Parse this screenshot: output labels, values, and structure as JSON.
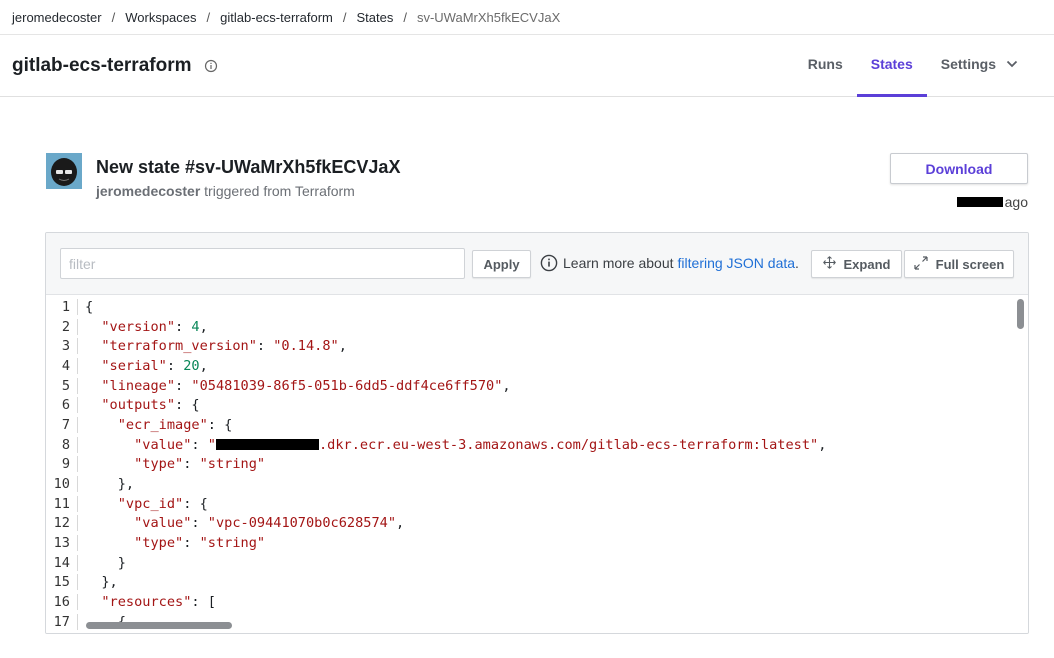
{
  "breadcrumb": {
    "items": [
      "jeromedecoster",
      "Workspaces",
      "gitlab-ecs-terraform",
      "States",
      "sv-UWaMrXh5fkECVJaX"
    ],
    "separator": "/"
  },
  "header": {
    "title": "gitlab-ecs-terraform",
    "tabs": [
      {
        "label": "Runs",
        "active": false
      },
      {
        "label": "States",
        "active": true
      },
      {
        "label": "Settings",
        "active": false
      }
    ]
  },
  "state": {
    "title": "New state #sv-UWaMrXh5fkECVJaX",
    "user": "jeromedecoster",
    "trigger_text": " triggered from Terraform",
    "download_label": "Download",
    "time_suffix": "ago"
  },
  "viewer": {
    "filter_placeholder": "filter",
    "apply_label": "Apply",
    "learn_text": "Learn more about",
    "learn_link": "filtering JSON data",
    "learn_end": ".",
    "expand_label": "Expand",
    "fullscreen_label": "Full screen",
    "lines": [
      {
        "n": "1",
        "segments": [
          {
            "t": "p",
            "v": "{"
          }
        ]
      },
      {
        "n": "2",
        "segments": [
          {
            "t": "p",
            "v": "  "
          },
          {
            "t": "k",
            "v": "\"version\""
          },
          {
            "t": "p",
            "v": ": "
          },
          {
            "t": "n",
            "v": "4"
          },
          {
            "t": "p",
            "v": ","
          }
        ]
      },
      {
        "n": "3",
        "segments": [
          {
            "t": "p",
            "v": "  "
          },
          {
            "t": "k",
            "v": "\"terraform_version\""
          },
          {
            "t": "p",
            "v": ": "
          },
          {
            "t": "s",
            "v": "\"0.14.8\""
          },
          {
            "t": "p",
            "v": ","
          }
        ]
      },
      {
        "n": "4",
        "segments": [
          {
            "t": "p",
            "v": "  "
          },
          {
            "t": "k",
            "v": "\"serial\""
          },
          {
            "t": "p",
            "v": ": "
          },
          {
            "t": "n",
            "v": "20"
          },
          {
            "t": "p",
            "v": ","
          }
        ]
      },
      {
        "n": "5",
        "segments": [
          {
            "t": "p",
            "v": "  "
          },
          {
            "t": "k",
            "v": "\"lineage\""
          },
          {
            "t": "p",
            "v": ": "
          },
          {
            "t": "s",
            "v": "\"05481039-86f5-051b-6dd5-ddf4ce6ff570\""
          },
          {
            "t": "p",
            "v": ","
          }
        ]
      },
      {
        "n": "6",
        "segments": [
          {
            "t": "p",
            "v": "  "
          },
          {
            "t": "k",
            "v": "\"outputs\""
          },
          {
            "t": "p",
            "v": ": {"
          }
        ]
      },
      {
        "n": "7",
        "segments": [
          {
            "t": "p",
            "v": "    "
          },
          {
            "t": "k",
            "v": "\"ecr_image\""
          },
          {
            "t": "p",
            "v": ": {"
          }
        ]
      },
      {
        "n": "8",
        "segments": [
          {
            "t": "p",
            "v": "      "
          },
          {
            "t": "k",
            "v": "\"value\""
          },
          {
            "t": "p",
            "v": ": "
          },
          {
            "t": "s",
            "v": "\""
          },
          {
            "t": "redact",
            "v": ""
          },
          {
            "t": "s",
            "v": ".dkr.ecr.eu-west-3.amazonaws.com/gitlab-ecs-terraform:latest\""
          },
          {
            "t": "p",
            "v": ","
          }
        ]
      },
      {
        "n": "9",
        "segments": [
          {
            "t": "p",
            "v": "      "
          },
          {
            "t": "k",
            "v": "\"type\""
          },
          {
            "t": "p",
            "v": ": "
          },
          {
            "t": "s",
            "v": "\"string\""
          }
        ]
      },
      {
        "n": "10",
        "segments": [
          {
            "t": "p",
            "v": "    },"
          }
        ]
      },
      {
        "n": "11",
        "segments": [
          {
            "t": "p",
            "v": "    "
          },
          {
            "t": "k",
            "v": "\"vpc_id\""
          },
          {
            "t": "p",
            "v": ": {"
          }
        ]
      },
      {
        "n": "12",
        "segments": [
          {
            "t": "p",
            "v": "      "
          },
          {
            "t": "k",
            "v": "\"value\""
          },
          {
            "t": "p",
            "v": ": "
          },
          {
            "t": "s",
            "v": "\"vpc-09441070b0c628574\""
          },
          {
            "t": "p",
            "v": ","
          }
        ]
      },
      {
        "n": "13",
        "segments": [
          {
            "t": "p",
            "v": "      "
          },
          {
            "t": "k",
            "v": "\"type\""
          },
          {
            "t": "p",
            "v": ": "
          },
          {
            "t": "s",
            "v": "\"string\""
          }
        ]
      },
      {
        "n": "14",
        "segments": [
          {
            "t": "p",
            "v": "    }"
          }
        ]
      },
      {
        "n": "15",
        "segments": [
          {
            "t": "p",
            "v": "  },"
          }
        ]
      },
      {
        "n": "16",
        "segments": [
          {
            "t": "p",
            "v": "  "
          },
          {
            "t": "k",
            "v": "\"resources\""
          },
          {
            "t": "p",
            "v": ": ["
          }
        ]
      },
      {
        "n": "17",
        "segments": [
          {
            "t": "p",
            "v": "    {"
          }
        ]
      }
    ]
  },
  "colors": {
    "accent": "#5b3fd8",
    "link": "#1f6fd6",
    "json_key": "#a31515",
    "json_number": "#098658"
  }
}
